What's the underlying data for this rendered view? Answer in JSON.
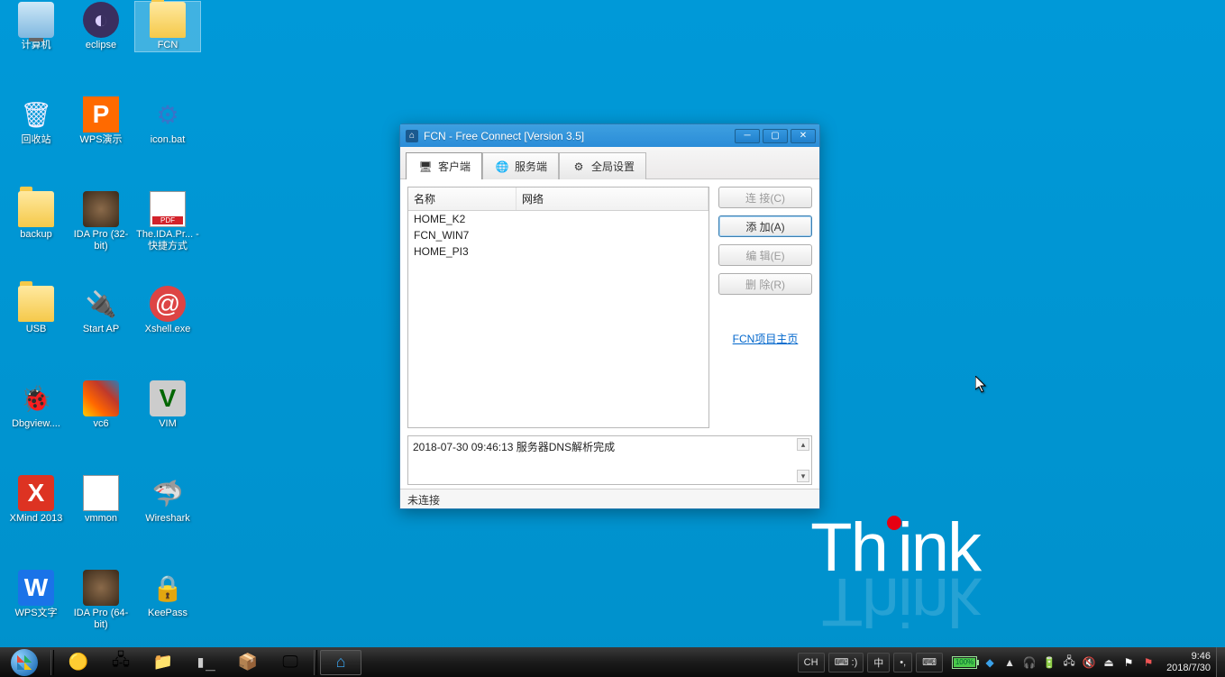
{
  "desktop": {
    "brand": "Think",
    "icons": [
      {
        "label": "计算机",
        "kind": "computer"
      },
      {
        "label": "eclipse",
        "kind": "eclipse"
      },
      {
        "label": "FCN",
        "kind": "folder",
        "selected": true
      },
      {
        "label": "回收站",
        "kind": "recycle"
      },
      {
        "label": "WPS演示",
        "kind": "wps-orange",
        "glyph": "P"
      },
      {
        "label": "icon.bat",
        "kind": "gear"
      },
      {
        "label": "backup",
        "kind": "folder"
      },
      {
        "label": "IDA Pro (32-bit)",
        "kind": "woman"
      },
      {
        "label": "The.IDA.Pr... - 快捷方式",
        "kind": "pdf"
      },
      {
        "label": "USB",
        "kind": "folder"
      },
      {
        "label": "Start AP",
        "kind": "usb"
      },
      {
        "label": "Xshell.exe",
        "kind": "spiral"
      },
      {
        "label": "Dbgview....",
        "kind": "bug"
      },
      {
        "label": "vc6",
        "kind": "vc6"
      },
      {
        "label": "VIM",
        "kind": "vim",
        "glyph": "V"
      },
      {
        "label": "XMind 2013",
        "kind": "xmind",
        "glyph": "X"
      },
      {
        "label": "vmmon",
        "kind": "vmmon"
      },
      {
        "label": "Wireshark",
        "kind": "wireshark"
      },
      {
        "label": "WPS文字",
        "kind": "wps-blue",
        "glyph": "W"
      },
      {
        "label": "IDA Pro (64-bit)",
        "kind": "woman"
      },
      {
        "label": "KeePass",
        "kind": "keepass"
      }
    ]
  },
  "window": {
    "title": "FCN - Free Connect [Version 3.5]",
    "tabs": [
      {
        "label": "客户端",
        "icon": "client-server-icon",
        "active": true
      },
      {
        "label": "服务端",
        "icon": "globe-icon",
        "active": false
      },
      {
        "label": "全局设置",
        "icon": "gear-icon",
        "active": false
      }
    ],
    "columns": {
      "name": "名称",
      "network": "网络"
    },
    "rows": [
      "HOME_K2",
      "FCN_WIN7",
      "HOME_PI3"
    ],
    "buttons": {
      "connect": "连 接(C)",
      "add": "添 加(A)",
      "edit": "编 辑(E)",
      "delete": "删 除(R)"
    },
    "link": "FCN项目主页",
    "log": "2018-07-30 09:46:13 服务器DNS解析完成",
    "status": "未连接"
  },
  "taskbar": {
    "lang": "CH",
    "ime_label": "中",
    "tray_chevron": "▲",
    "battery_pct": "100%",
    "clock_time": "9:46",
    "clock_date": "2018/7/30"
  }
}
